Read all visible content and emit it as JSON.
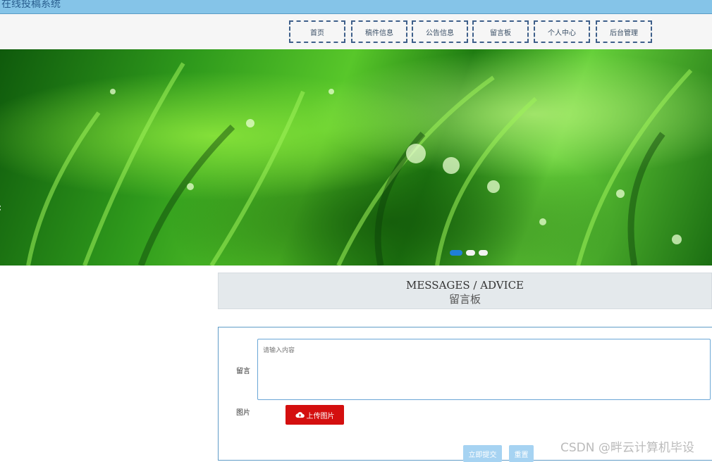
{
  "app": {
    "title": "在线投稿系统"
  },
  "nav": {
    "items": [
      {
        "label": "首页"
      },
      {
        "label": "稿件信息"
      },
      {
        "label": "公告信息"
      },
      {
        "label": "留言板"
      },
      {
        "label": "个人中心"
      },
      {
        "label": "后台管理"
      }
    ]
  },
  "carousel": {
    "prev_symbol": "‹",
    "slide_count": 3,
    "active_index": 0,
    "active_color": "#1f7fd6"
  },
  "section": {
    "title_en": "MESSAGES / ADVICE",
    "title_zh": "留言板"
  },
  "form": {
    "message_label": "留言",
    "message_placeholder": "请输入内容",
    "image_label": "图片",
    "upload_label": "上传图片",
    "upload_icon": "cloud-upload-icon",
    "upload_color": "#d40f0f",
    "submit_label": "立即提交",
    "reset_label": "重置"
  },
  "watermark": "CSDN @畔云计算机毕设"
}
